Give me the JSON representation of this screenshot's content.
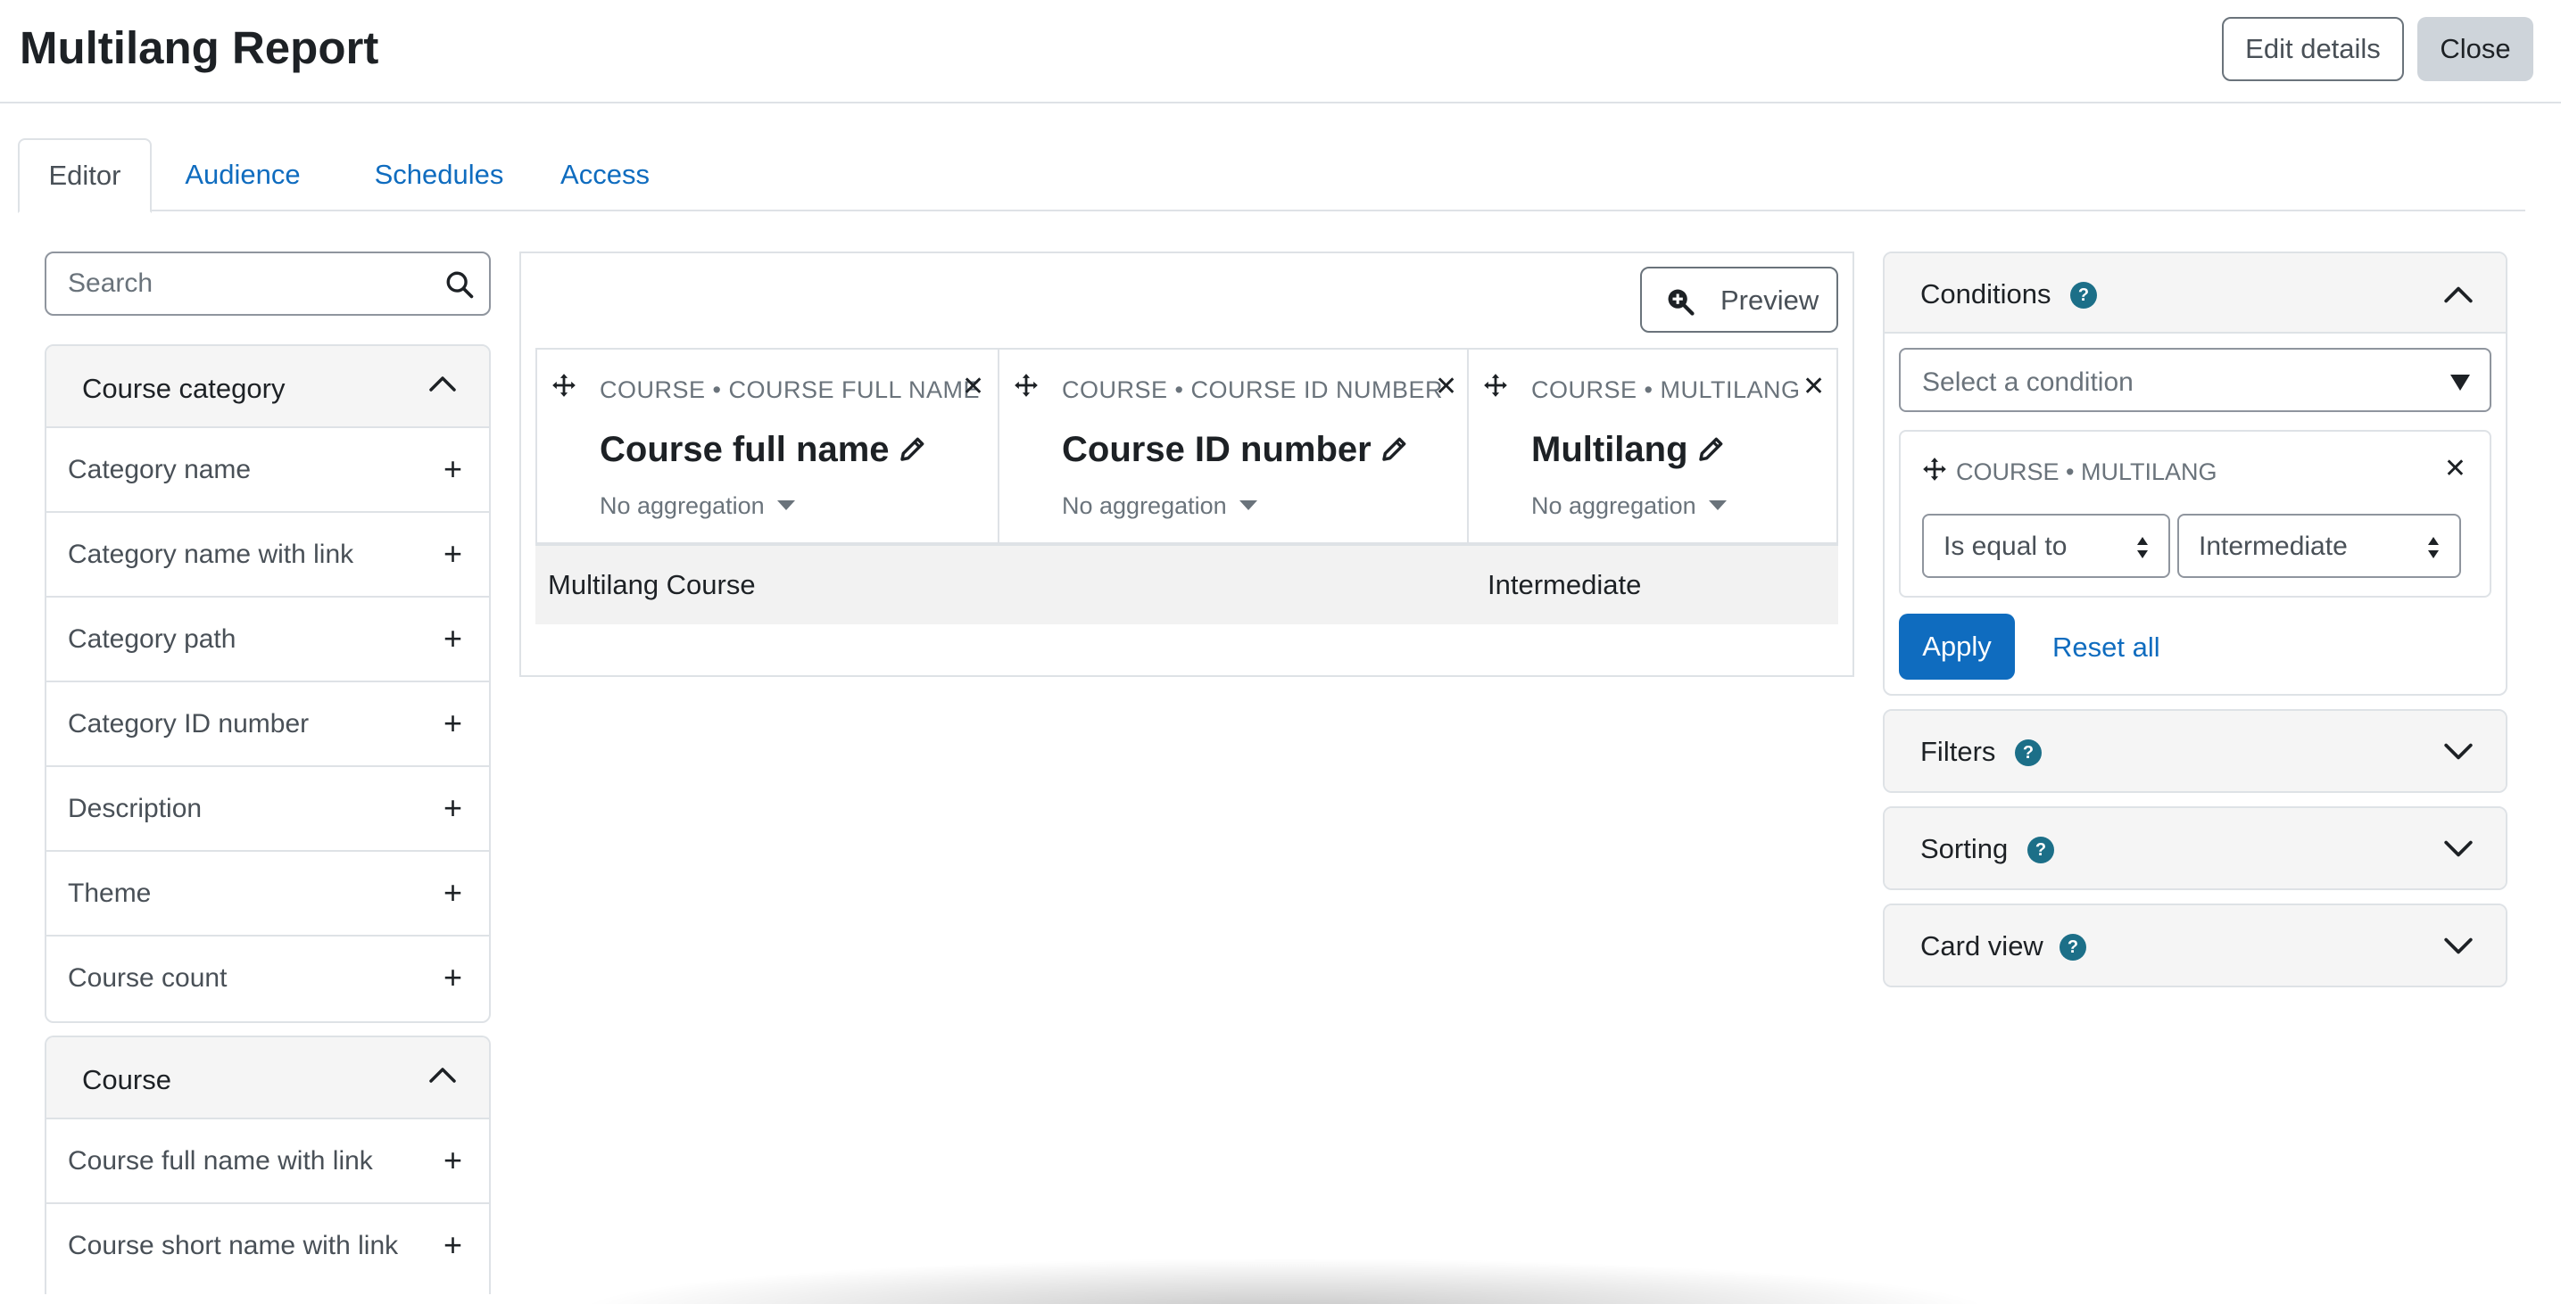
{
  "header": {
    "title": "Multilang Report",
    "edit_details_label": "Edit details",
    "close_label": "Close"
  },
  "tabs": [
    {
      "label": "Editor",
      "active": true
    },
    {
      "label": "Audience",
      "active": false
    },
    {
      "label": "Schedules",
      "active": false
    },
    {
      "label": "Access",
      "active": false
    }
  ],
  "sidebar": {
    "search_placeholder": "Search",
    "groups": [
      {
        "title": "Course category",
        "expanded": true,
        "items": [
          "Category name",
          "Category name with link",
          "Category path",
          "Category ID number",
          "Description",
          "Theme",
          "Course count"
        ]
      },
      {
        "title": "Course",
        "expanded": true,
        "items": [
          "Course full name with link",
          "Course short name with link"
        ]
      }
    ]
  },
  "report": {
    "preview_label": "Preview",
    "columns": [
      {
        "path": "COURSE • COURSE FULL NAME",
        "name": "Course full name",
        "aggregation": "No aggregation"
      },
      {
        "path": "COURSE • COURSE ID NUMBER",
        "name": "Course ID number",
        "aggregation": "No aggregation"
      },
      {
        "path": "COURSE • MULTILANG",
        "name": "Multilang",
        "aggregation": "No aggregation"
      }
    ],
    "rows": [
      [
        "Multilang Course",
        "",
        "Intermediate"
      ]
    ]
  },
  "conditions": {
    "title": "Conditions",
    "help_icon": "question-circle-icon",
    "select_placeholder": "Select a condition",
    "items": [
      {
        "path": "COURSE • MULTILANG",
        "operator": "Is equal to",
        "value": "Intermediate"
      }
    ],
    "apply_label": "Apply",
    "reset_label": "Reset all"
  },
  "panels": [
    {
      "title": "Filters"
    },
    {
      "title": "Sorting"
    },
    {
      "title": "Card view"
    }
  ],
  "colors": {
    "link": "#0f6cbf",
    "help_badge": "#1c6f88",
    "apply_bg": "#0f6cbf",
    "border": "#dee2e6"
  }
}
